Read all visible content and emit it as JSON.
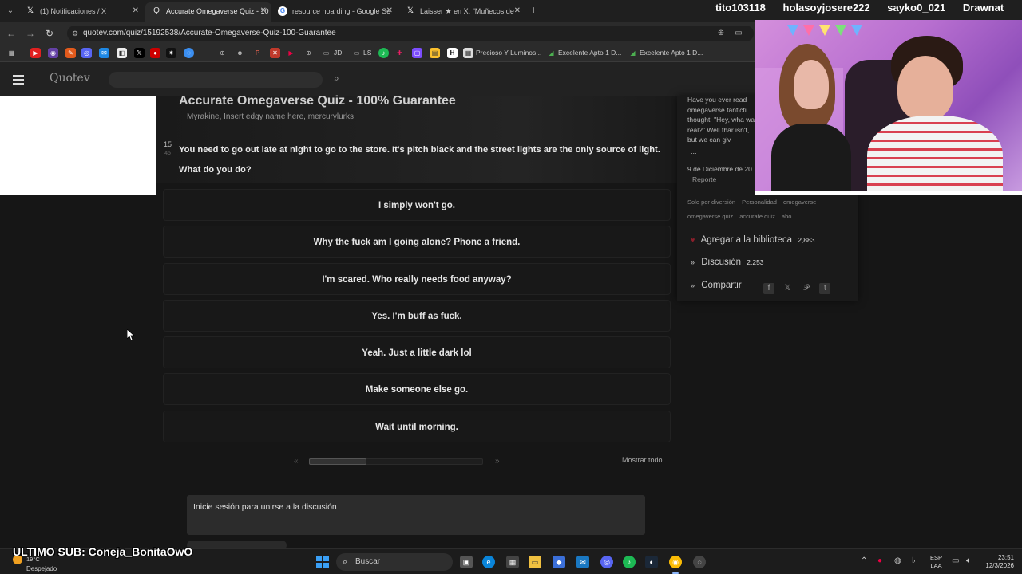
{
  "browser": {
    "tabs": [
      {
        "label": "(1) Notificaciones / X",
        "icon": "x-logo-icon"
      },
      {
        "label": "Accurate Omegaverse Quiz - 10",
        "icon": "quotev-icon",
        "active": true
      },
      {
        "label": "resource hoarding - Google Se",
        "icon": "google-icon"
      },
      {
        "label": "Laisser ★ en X: \"Muñecos de",
        "icon": "x-logo-icon"
      }
    ],
    "new_tab": "+",
    "url": "quotev.com/quiz/15192538/Accurate-Omegaverse-Quiz-100-Guarantee",
    "bookmarks_text": [
      "JD",
      "LS",
      "Precioso Y Luminos...",
      "Excelente Apto 1 D...",
      "Excelente Apto 1 D..."
    ]
  },
  "stream": {
    "usernames": [
      "tito103118",
      "holasoyjosere222",
      "sayko0_021",
      "Drawnat"
    ],
    "last_sub": "ULTIMO SUB: Coneja_BonitaOwO"
  },
  "site": {
    "logo": "Quotev",
    "search_placeholder": ""
  },
  "quiz": {
    "title": "Accurate Omegaverse Quiz - 100% Guarantee",
    "authors": "Myrakine,  Insert edgy name here,  mercurylurks",
    "question_number": "15",
    "question_total": "45",
    "question": "You need to go out late at night to go to the store. It's pitch black and the street lights are the only source of light. What do you do?",
    "answers": [
      "I simply won't go.",
      "Why the fuck am I going alone? Phone a friend.",
      "I'm scared. Who really needs food anyway?",
      "Yes. I'm buff as fuck.",
      "Yeah. Just a little dark lol",
      "Make someone else go.",
      "Wait until morning."
    ],
    "pager": {
      "prev": "«",
      "next": "»",
      "show_all": "Mostrar todo",
      "progress": 0.33
    },
    "discussion_prompt": "Inicie sesión para unirse a la discusión"
  },
  "sidebar": {
    "description": "Have you ever read omegaverse fanficti thought, \"Hey, wha was real?\" Well thar isn't, but we can giv",
    "ellipsis": "...",
    "date": "9 de Diciembre de 20",
    "report": "Reporte",
    "tags": [
      "Solo por diversión",
      "Personalidad",
      "omegaverse",
      "omegaverse quiz",
      "accurate quiz",
      "abo",
      "..."
    ],
    "library": {
      "label": "Agregar a la biblioteca",
      "count": "2,883"
    },
    "discussion": {
      "label": "Discusión",
      "count": "2,253"
    },
    "share": {
      "label": "Compartir"
    }
  },
  "taskbar": {
    "weather_temp": "19°C",
    "weather_desc": "Despejado",
    "search": "Buscar",
    "lang_top": "ESP",
    "lang_bottom": "LAA",
    "time": "23:51",
    "date": "12/3/2026"
  }
}
